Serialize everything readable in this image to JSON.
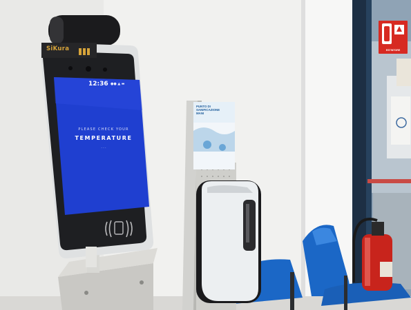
{
  "scene": {
    "title": "",
    "palette": {
      "wall": "#f3f3f1",
      "screen_blue": "#1f3fd0",
      "chair_blue": "#1b67c6",
      "extinguisher_red": "#c8241c",
      "window_frame": "#1d2f44"
    }
  },
  "kiosk": {
    "brand": "SiKura",
    "brand_tag": "",
    "screen": {
      "clock": "12:36",
      "status": "●● ▲ ▬",
      "prompt": "PLEASE CHECK YOUR",
      "headline": "TEMPERATURE",
      "hint": "· · ·"
    },
    "icons": [
      "contactless-reader-icon",
      "camera-icon"
    ]
  },
  "poster": {
    "title_lines": [
      "PUNTO DI",
      "SANIFICAZIONE",
      "MANI"
    ]
  },
  "fire_sign": {
    "label": "ESTINTORE"
  }
}
